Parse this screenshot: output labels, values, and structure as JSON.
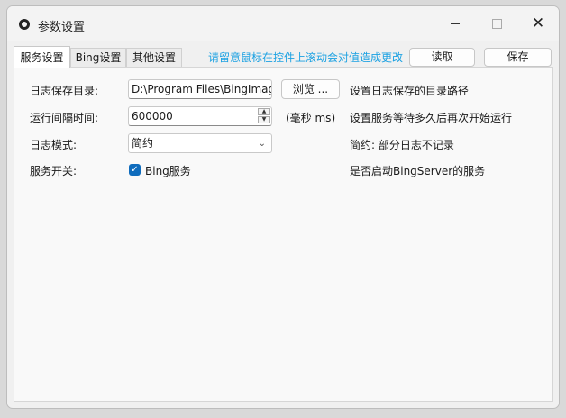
{
  "window": {
    "title": "参数设置"
  },
  "tabs": [
    "服务设置",
    "Bing设置",
    "其他设置"
  ],
  "header": {
    "hint": "请留意鼠标在控件上滚动会对值造成更改",
    "read_label": "读取",
    "save_label": "保存"
  },
  "settings": {
    "log_dir": {
      "label": "日志保存目录:",
      "value": "D:\\Program Files\\BingImag",
      "browse_label": "浏览 ...",
      "desc": "设置日志保存的目录路径"
    },
    "interval": {
      "label": "运行间隔时间:",
      "value": "600000",
      "unit": "(毫秒 ms)",
      "desc": "设置服务等待多久后再次开始运行"
    },
    "log_mode": {
      "label": "日志模式:",
      "value": "简约",
      "desc": "简约: 部分日志不记录"
    },
    "service_switch": {
      "label": "服务开关:",
      "checkbox_label": "Bing服务",
      "checked": true,
      "desc": "是否启动BingServer的服务"
    }
  }
}
